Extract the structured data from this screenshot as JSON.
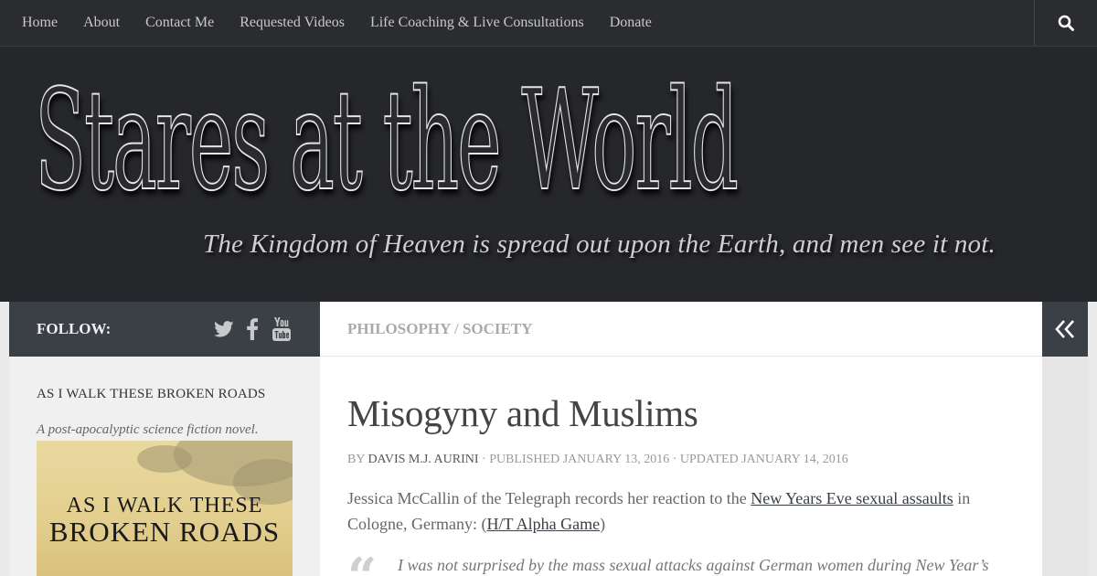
{
  "nav": {
    "items": [
      "Home",
      "About",
      "Contact Me",
      "Requested Videos",
      "Life Coaching & Live Consultations",
      "Donate"
    ]
  },
  "header": {
    "title": "Stares at the World",
    "tagline": "The Kingdom of Heaven is spread out upon the Earth, and men see it not."
  },
  "follow": {
    "label": "FOLLOW:",
    "icons": [
      "twitter-icon",
      "facebook-icon",
      "youtube-icon"
    ]
  },
  "categories": {
    "first": "PHILOSOPHY",
    "separator": "/",
    "second": "SOCIETY"
  },
  "sidebar": {
    "widget_title": "AS I WALK THESE BROKEN ROADS",
    "widget_desc": "A post-apocalyptic science fiction novel.",
    "book_line1": "AS I WALK THESE",
    "book_line2": "BROKEN ROADS"
  },
  "post": {
    "title": "Misogyny and Muslims",
    "by": "BY",
    "author": "DAVIS M.J. AURINI",
    "published": "· PUBLISHED JANUARY 13, 2016 · UPDATED JANUARY 14, 2016",
    "para_text1": "Jessica McCallin of the Telegraph records her reaction to the ",
    "para_link1": "New Years Eve sexual assaults",
    "para_text2": " in Cologne, Germany:  (",
    "para_link2": "H/T Alpha Game",
    "para_text3": ")",
    "quote": "I was not surprised by the mass sexual attacks against German women during New Year’s"
  },
  "colors": {
    "nav_bg": "#2b2c30",
    "header_bg": "#26272a",
    "bar_bg": "#3b4046",
    "link": "#3b4046"
  }
}
